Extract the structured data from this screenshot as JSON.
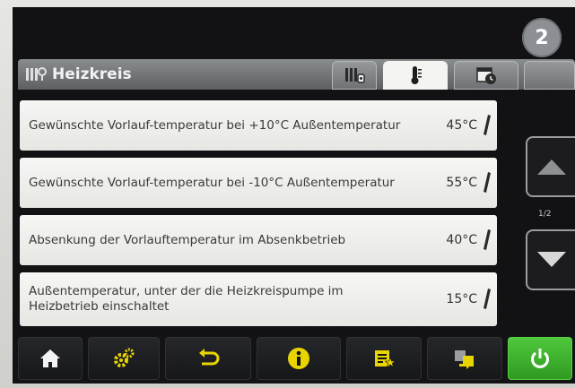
{
  "badge": "2",
  "header": {
    "title": "Heizkreis"
  },
  "rows": [
    {
      "label": "Gewünschte Vorlauf-temperatur bei +10°C Außentemperatur",
      "value": "45°C"
    },
    {
      "label": "Gewünschte Vorlauf-temperatur bei -10°C Außentemperatur",
      "value": "55°C"
    },
    {
      "label": "Absenkung der Vorlauftemperatur im Absenkbetrieb",
      "value": "40°C"
    },
    {
      "label": "Außentemperatur, unter der die Heizkreispumpe im Heizbetrieb einschaltet",
      "value": "15°C"
    }
  ],
  "pager": {
    "indicator": "1/2"
  },
  "colors": {
    "accent_green": "#3db32b",
    "icon_yellow": "#e8d400",
    "header_gray": "#7a7d80"
  },
  "icons": {
    "header": "radiator-info-icon",
    "tabs": [
      "radiator-settings-icon",
      "thermometer-icon",
      "calendar-clock-icon"
    ],
    "toolbar": [
      "home-icon",
      "gears-icon",
      "back-arrow-icon",
      "info-icon",
      "list-star-icon",
      "transfer-icon",
      "power-icon"
    ]
  }
}
